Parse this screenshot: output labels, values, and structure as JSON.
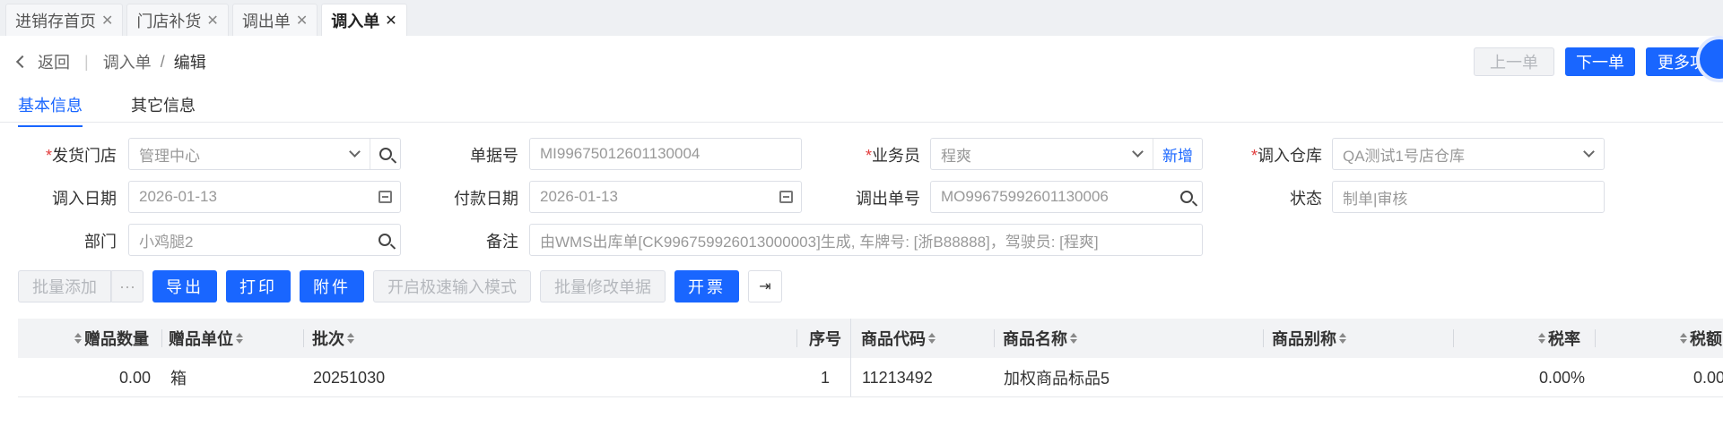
{
  "tabs": [
    {
      "label": "进销存首页"
    },
    {
      "label": "门店补货"
    },
    {
      "label": "调出单"
    },
    {
      "label": "调入单",
      "active": true
    }
  ],
  "breadcrumb": {
    "back": "返回",
    "parent": "调入单",
    "separator": "/",
    "current": "编辑"
  },
  "top_buttons": {
    "prev": "上一单",
    "next": "下一单",
    "more": "更多功"
  },
  "subtabs": [
    "基本信息",
    "其它信息"
  ],
  "form": {
    "ship_store_label": "发货门店",
    "ship_store_value": "管理中心",
    "doc_no_label": "单据号",
    "doc_no_value": "MI99675012601130004",
    "salesman_label": "业务员",
    "salesman_value": "程爽",
    "salesman_add": "新增",
    "in_warehouse_label": "调入仓库",
    "in_warehouse_value": "QA测试1号店仓库",
    "in_date_label": "调入日期",
    "in_date_value": "2026-01-13",
    "pay_date_label": "付款日期",
    "pay_date_value": "2026-01-13",
    "out_no_label": "调出单号",
    "out_no_value": "MO99675992601130006",
    "status_label": "状态",
    "status_value": "制单|审核",
    "dept_label": "部门",
    "dept_value": "小鸡腿2",
    "remark_label": "备注",
    "remark_value": "由WMS出库单[CK996759926013000003]生成, 车牌号: [浙B88888]，驾驶员: [程爽]"
  },
  "toolbar": {
    "batch_add": "批量添加",
    "more": "···",
    "export": "导出",
    "print": "打印",
    "attach": "附件",
    "fast_mode": "开启极速输入模式",
    "batch_edit": "批量修改单据",
    "invoice": "开票",
    "columns_icon": "column-settings-icon"
  },
  "table": {
    "headers": {
      "gift_qty": "赠品数量",
      "gift_unit": "赠品单位",
      "batch": "批次",
      "seq": "序号",
      "code": "商品代码",
      "name": "商品名称",
      "alias": "商品别称",
      "tax_rate": "税率",
      "tax_amount": "税额"
    },
    "rows": [
      {
        "gift_qty": "0.00",
        "gift_unit": "箱",
        "batch": "20251030",
        "seq": "1",
        "code": "11213492",
        "name": "加权商品标品5",
        "alias": "",
        "tax_rate": "0.00%",
        "tax_amount": "0.00"
      }
    ]
  },
  "colors": {
    "primary": "#1966ff",
    "required": "#e23c3c"
  }
}
